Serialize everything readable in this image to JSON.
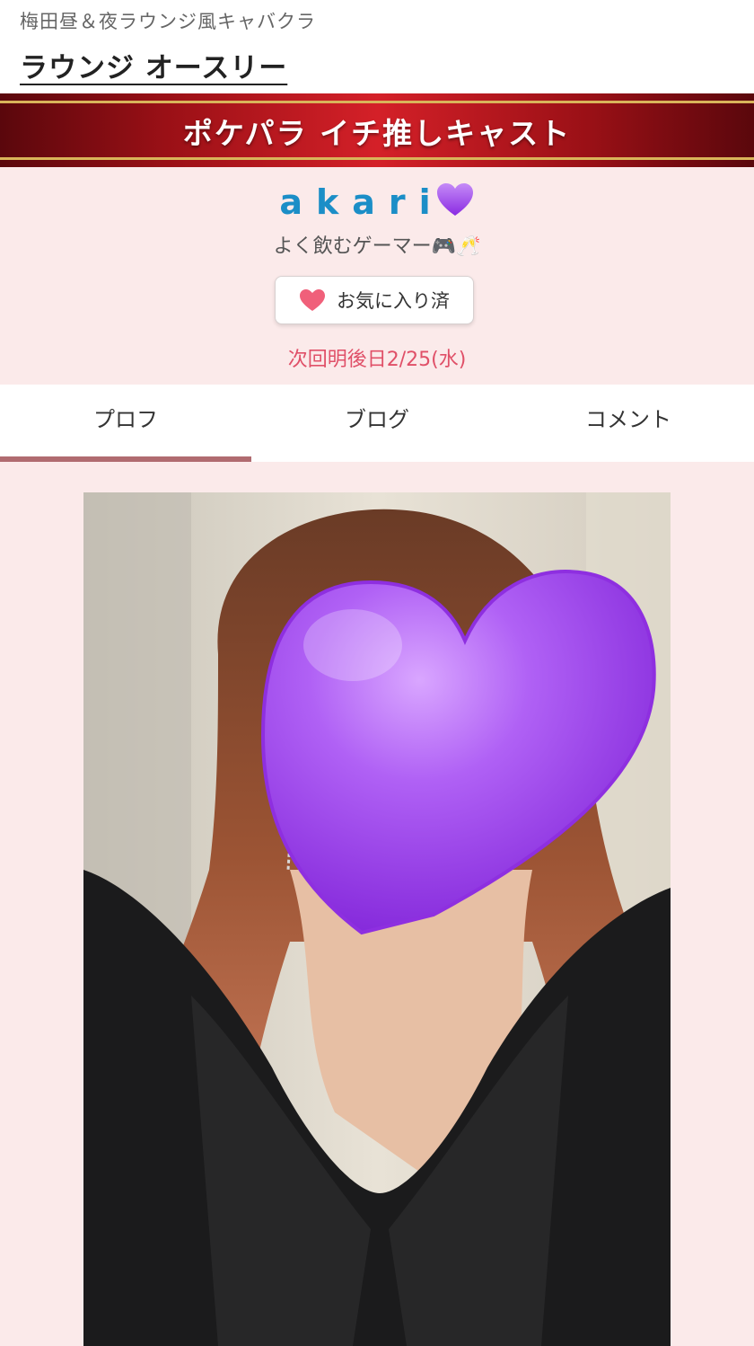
{
  "header": {
    "shop_genre": "梅田昼＆夜ラウンジ風キャバクラ",
    "shop_name": "ラウンジ オースリー"
  },
  "banner": {
    "title": "ポケパラ イチ推しキャスト"
  },
  "profile": {
    "name": "akari",
    "name_emoji_icon": "purple-heart-icon",
    "catchphrase": "よく飲むゲーマー",
    "catchphrase_emoji": "🎮🥂",
    "favorite_button_label": "お気に入り済",
    "favorite_icon": "heart-icon",
    "next_shift": "次回明後日2/25(水)"
  },
  "tabs": [
    {
      "label": "プロフ",
      "active": true
    },
    {
      "label": "ブログ",
      "active": false
    },
    {
      "label": "コメント",
      "active": false
    }
  ],
  "colors": {
    "accent_red": "#d42028",
    "gold_line": "#d9b45a",
    "name_blue": "#1b8ec7",
    "shift_pink": "#e05068",
    "tab_underline": "#b06b70",
    "page_bg": "#fbeaea",
    "heart_purple": "#a040ec"
  }
}
